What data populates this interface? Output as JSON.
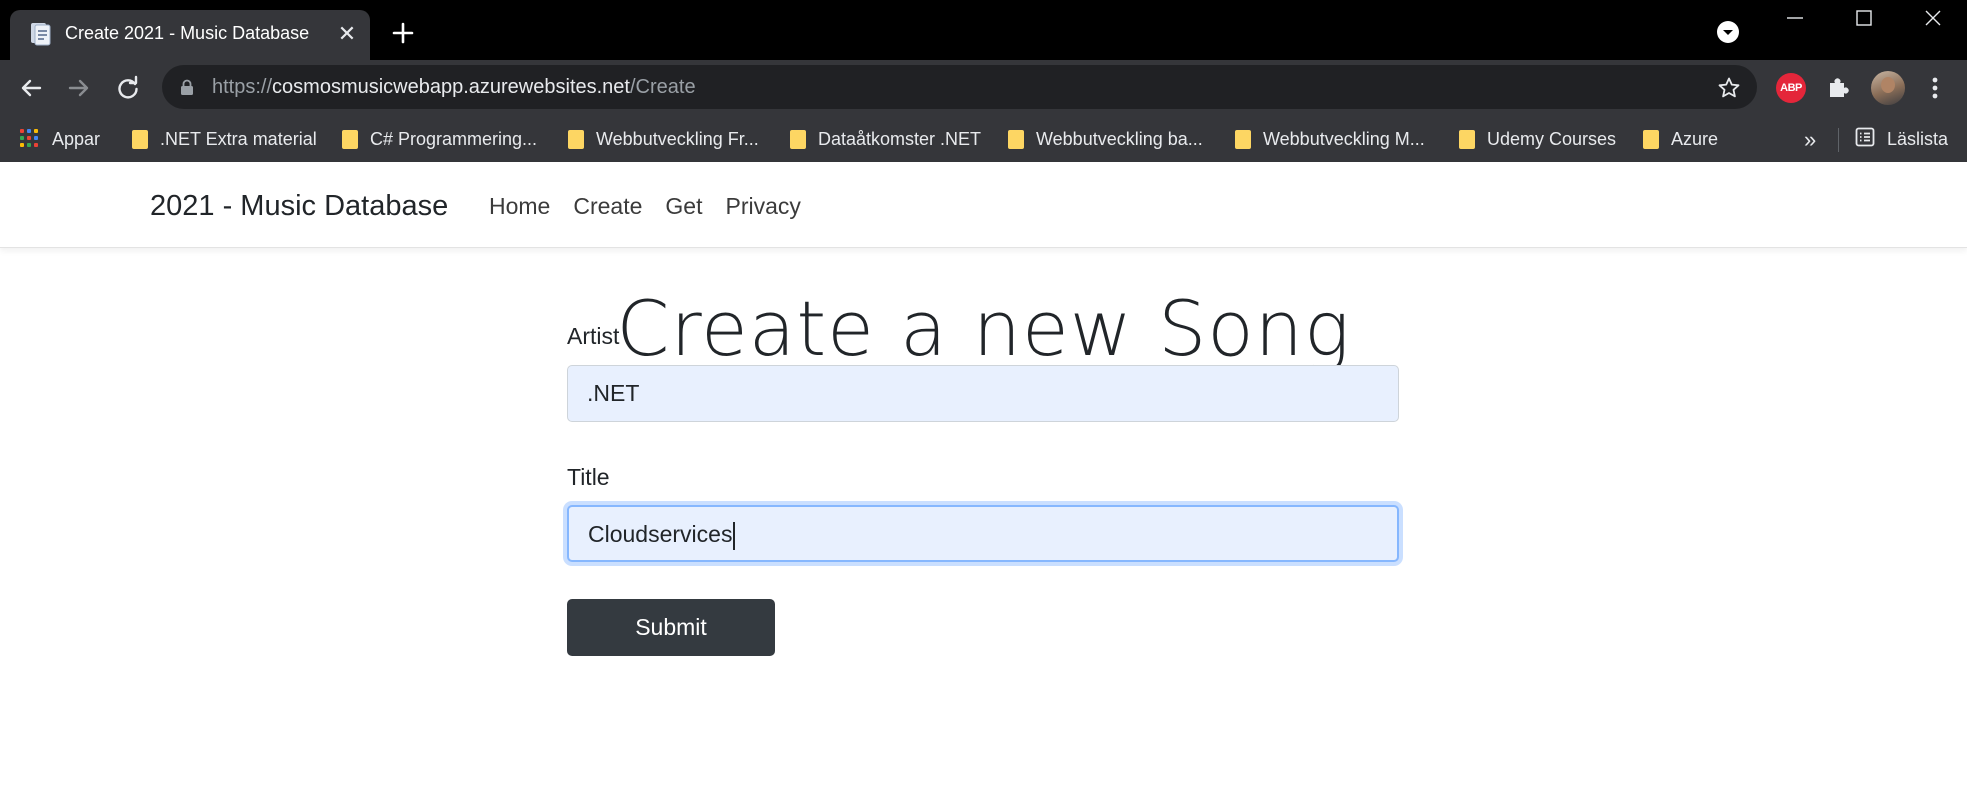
{
  "browser": {
    "tab_title": "Create 2021 - Music Database",
    "url": {
      "scheme": "https://",
      "host": "cosmosmusicwebapp.azurewebsites.net",
      "path": "/Create"
    },
    "extension_badge": "ABP",
    "bookmarks": [
      {
        "label": "Appar",
        "icon": "apps-grid-icon"
      },
      {
        "label": ".NET Extra material",
        "icon": "folder-icon"
      },
      {
        "label": "C# Programmering...",
        "icon": "folder-icon"
      },
      {
        "label": "Webbutveckling Fr...",
        "icon": "folder-icon"
      },
      {
        "label": "Dataåtkomster .NET",
        "icon": "folder-icon"
      },
      {
        "label": "Webbutveckling ba...",
        "icon": "folder-icon"
      },
      {
        "label": "Webbutveckling M...",
        "icon": "folder-icon"
      },
      {
        "label": "Udemy Courses",
        "icon": "folder-icon"
      },
      {
        "label": "Azure",
        "icon": "folder-icon"
      }
    ],
    "bookmarks_overflow": "»",
    "reading_list": "Läslista"
  },
  "site": {
    "brand": "2021 - Music Database",
    "nav": [
      "Home",
      "Create",
      "Get",
      "Privacy"
    ]
  },
  "form": {
    "heading": "Create a new Song",
    "artist_label": "Artist",
    "artist_value": ".NET",
    "title_label": "Title",
    "title_value": "Cloudservices",
    "submit_label": "Submit"
  },
  "colors": {
    "tabstrip": "#000000",
    "toolbar": "#35363a",
    "omnibox": "#202124",
    "input_autofill": "#e8f0fe",
    "focus_ring": "#86b7fe",
    "submit_button": "#343a40"
  }
}
